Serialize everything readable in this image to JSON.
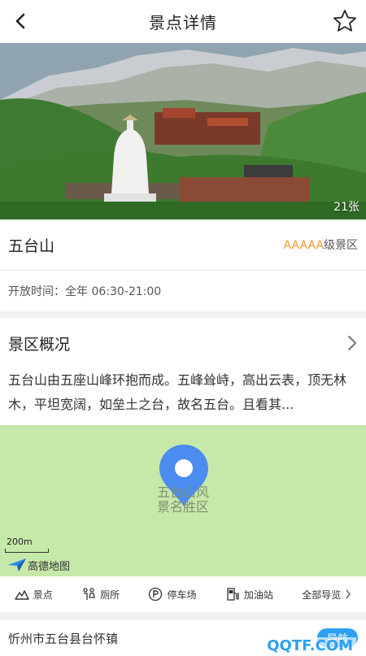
{
  "header": {
    "title": "景点详情"
  },
  "hero": {
    "photo_count": "21张"
  },
  "spot": {
    "name": "五台山",
    "grade_stars": "AAAAA",
    "grade_suffix": "级景区",
    "accent": "#f39c32"
  },
  "hours": {
    "text": "开放时间：全年 06:30-21:00"
  },
  "overview": {
    "heading": "景区概况",
    "body": "五台山由五座山峰环抱而成。五峰耸峙，高出云表，顶无林木，平坦宽阔，如垒土之台，故名五台。且看其..."
  },
  "map": {
    "label_line1": "五台山风",
    "label_line2": "景名胜区",
    "scale": "200m",
    "provider": "高德地图",
    "pin_color": "#4a8cf0"
  },
  "poi_bar": {
    "items": [
      {
        "label": "景点",
        "icon": "mountain-icon"
      },
      {
        "label": "厕所",
        "icon": "toilet-icon"
      },
      {
        "label": "停车场",
        "icon": "parking-icon"
      },
      {
        "label": "加油站",
        "icon": "gas-station-icon"
      },
      {
        "label": "全部导览",
        "icon": "chevron-right-icon"
      }
    ]
  },
  "address": {
    "text": "忻州市五台县台怀镇",
    "nav_label": "导航"
  },
  "watermark": "QQTF.COM"
}
